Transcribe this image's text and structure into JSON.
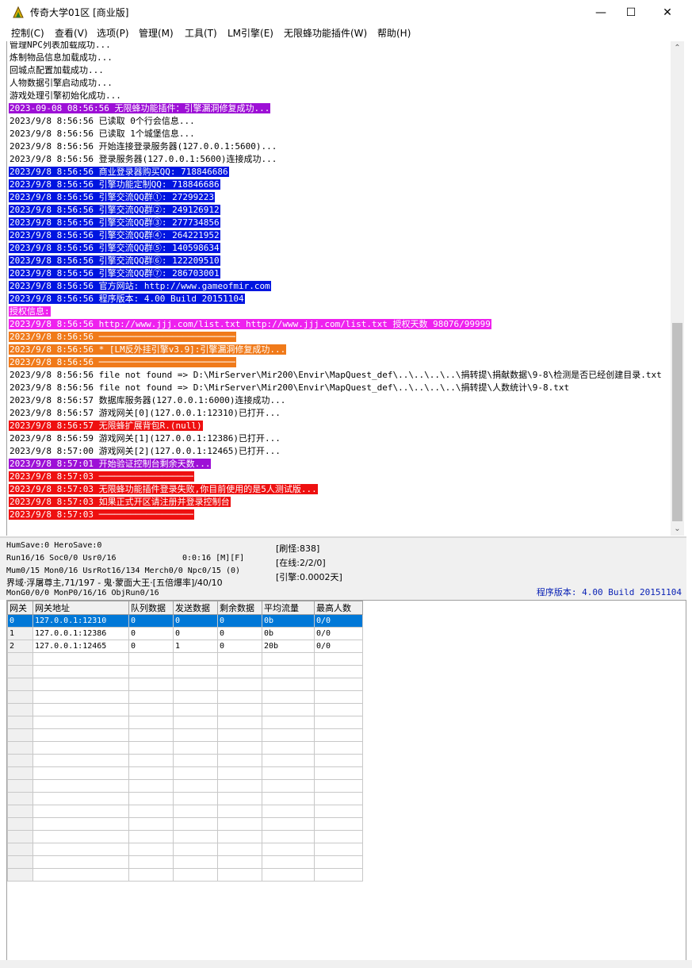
{
  "window": {
    "title": "传奇大学01区 [商业版]",
    "minimize": "—",
    "maximize": "☐",
    "close": "✕"
  },
  "menu": [
    "控制(C)",
    "查看(V)",
    "选项(P)",
    "管理(M)",
    "工具(T)",
    "LM引擎(E)",
    "无限蜂功能插件(W)",
    "帮助(H)"
  ],
  "log": [
    {
      "text": "管理NPC列表加载成功...",
      "style": ""
    },
    {
      "text": "炼制物品信息加载成功...",
      "style": ""
    },
    {
      "text": "回城点配置加载成功...",
      "style": ""
    },
    {
      "text": "人物数据引擎启动成功...",
      "style": ""
    },
    {
      "text": "游戏处理引擎初始化成功...",
      "style": ""
    },
    {
      "text": "2023-09-08 08:56:56 无限蜂功能插件：引擎漏洞修复成功...",
      "style": "purple"
    },
    {
      "text": "2023/9/8 8:56:56 已读取 0个行会信息...",
      "style": ""
    },
    {
      "text": "2023/9/8 8:56:56 已读取 1个城堡信息...",
      "style": ""
    },
    {
      "text": "2023/9/8 8:56:56 开始连接登录服务器(127.0.0.1:5600)...",
      "style": ""
    },
    {
      "text": "2023/9/8 8:56:56 登录服务器(127.0.0.1:5600)连接成功...",
      "style": ""
    },
    {
      "text": "2023/9/8 8:56:56 商业登录器购买QQ: 718846686",
      "style": "blue"
    },
    {
      "text": "2023/9/8 8:56:56 引擎功能定制QQ: 718846686",
      "style": "blue"
    },
    {
      "text": "2023/9/8 8:56:56 引擎交流QQ群①: 27299223",
      "style": "blue"
    },
    {
      "text": "2023/9/8 8:56:56 引擎交流QQ群②: 249126912",
      "style": "blue"
    },
    {
      "text": "2023/9/8 8:56:56 引擎交流QQ群③: 277734856",
      "style": "blue"
    },
    {
      "text": "2023/9/8 8:56:56 引擎交流QQ群④: 264221952",
      "style": "blue"
    },
    {
      "text": "2023/9/8 8:56:56 引擎交流QQ群⑤: 140598634",
      "style": "blue"
    },
    {
      "text": "2023/9/8 8:56:56 引擎交流QQ群⑥: 122209510",
      "style": "blue"
    },
    {
      "text": "2023/9/8 8:56:56 引擎交流QQ群⑦: 286703001",
      "style": "blue"
    },
    {
      "text": "2023/9/8 8:56:56 官方网站: http://www.gameofmir.com",
      "style": "blue"
    },
    {
      "text": "2023/9/8 8:56:56 程序版本: 4.00 Build 20151104",
      "style": "blue"
    },
    {
      "text": "授权信息:",
      "style": "magenta"
    },
    {
      "text": "2023/9/8 8:56:56 http://www.jjj.com/list.txt http://www.jjj.com/list.txt 授权天数 98076/99999",
      "style": "magenta"
    },
    {
      "text": "2023/9/8 8:56:56 ──────────────────────────",
      "style": "orange"
    },
    {
      "text": "2023/9/8 8:56:56 * [LM反外挂引擎v3.9]:引擎漏洞修复成功...",
      "style": "orange"
    },
    {
      "text": "2023/9/8 8:56:56 ──────────────────────────",
      "style": "orange"
    },
    {
      "text": "2023/9/8 8:56:56 file not found => D:\\MirServer\\Mir200\\Envir\\MapQuest_def\\..\\..\\..\\..\\捐转提\\捐献数据\\9-8\\检测是否已经创建目录.txt",
      "style": ""
    },
    {
      "text": "2023/9/8 8:56:56 file not found => D:\\MirServer\\Mir200\\Envir\\MapQuest_def\\..\\..\\..\\..\\捐转提\\人数统计\\9-8.txt",
      "style": ""
    },
    {
      "text": "2023/9/8 8:56:57 数据库服务器(127.0.0.1:6000)连接成功...",
      "style": ""
    },
    {
      "text": "2023/9/8 8:56:57 游戏网关[0](127.0.0.1:12310)已打开...",
      "style": ""
    },
    {
      "text": "2023/9/8 8:56:57 无限蜂扩展背包R.(null)",
      "style": "red"
    },
    {
      "text": "2023/9/8 8:56:59 游戏网关[1](127.0.0.1:12386)已打开...",
      "style": ""
    },
    {
      "text": "2023/9/8 8:57:00 游戏网关[2](127.0.0.1:12465)已打开...",
      "style": ""
    },
    {
      "text": "2023/9/8 8:57:01 开始验证控制台剩余天数...",
      "style": "purple"
    },
    {
      "text": "2023/9/8 8:57:03 ──────────────────",
      "style": "red"
    },
    {
      "text": "2023/9/8 8:57:03 无限蜂功能插件登录失败,你目前使用的是5人测试版...",
      "style": "red"
    },
    {
      "text": "2023/9/8 8:57:03 如果正式开区请注册并登录控制台",
      "style": "red"
    },
    {
      "text": "2023/9/8 8:57:03 ──────────────────",
      "style": "red"
    }
  ],
  "status": {
    "line1": "HumSave:0 HeroSave:0",
    "line2a": "Run16/16 Soc0/0 Usr0/16",
    "line2b": "0:0:16 [M][F]",
    "line3": "Mum0/15 Mon0/16 UsrRot16/134 Merch0/0 Npc0/15 (0)",
    "line4": "界域·浮屠尊主,71/197 - 鬼·蒙面大王·[五倍爆率]/40/10",
    "line5": "MonG0/0/0 MonP0/16/16 ObjRun0/16",
    "refresh": "[刷怪:838]",
    "online": "[在线:2/2/0]",
    "engine": "[引擎:0.0002天]",
    "version": "程序版本: 4.00 Build 20151104"
  },
  "grid": {
    "headers": [
      "网关",
      "网关地址",
      "队列数据",
      "发送数据",
      "剩余数据",
      "平均流量",
      "最高人数"
    ],
    "rows": [
      [
        "0",
        "127.0.0.1:12310",
        "0",
        "0",
        "0",
        "0b",
        "0/0"
      ],
      [
        "1",
        "127.0.0.1:12386",
        "0",
        "0",
        "0",
        "0b",
        "0/0"
      ],
      [
        "2",
        "127.0.0.1:12465",
        "0",
        "1",
        "0",
        "20b",
        "0/0"
      ]
    ],
    "empty_rows": 18
  },
  "colors": {
    "purple": "#9d10d6",
    "blue": "#0015e0",
    "magenta": "#ee22ee",
    "orange": "#f07a1a",
    "red": "#ee1010",
    "selection": "#0078d7"
  }
}
